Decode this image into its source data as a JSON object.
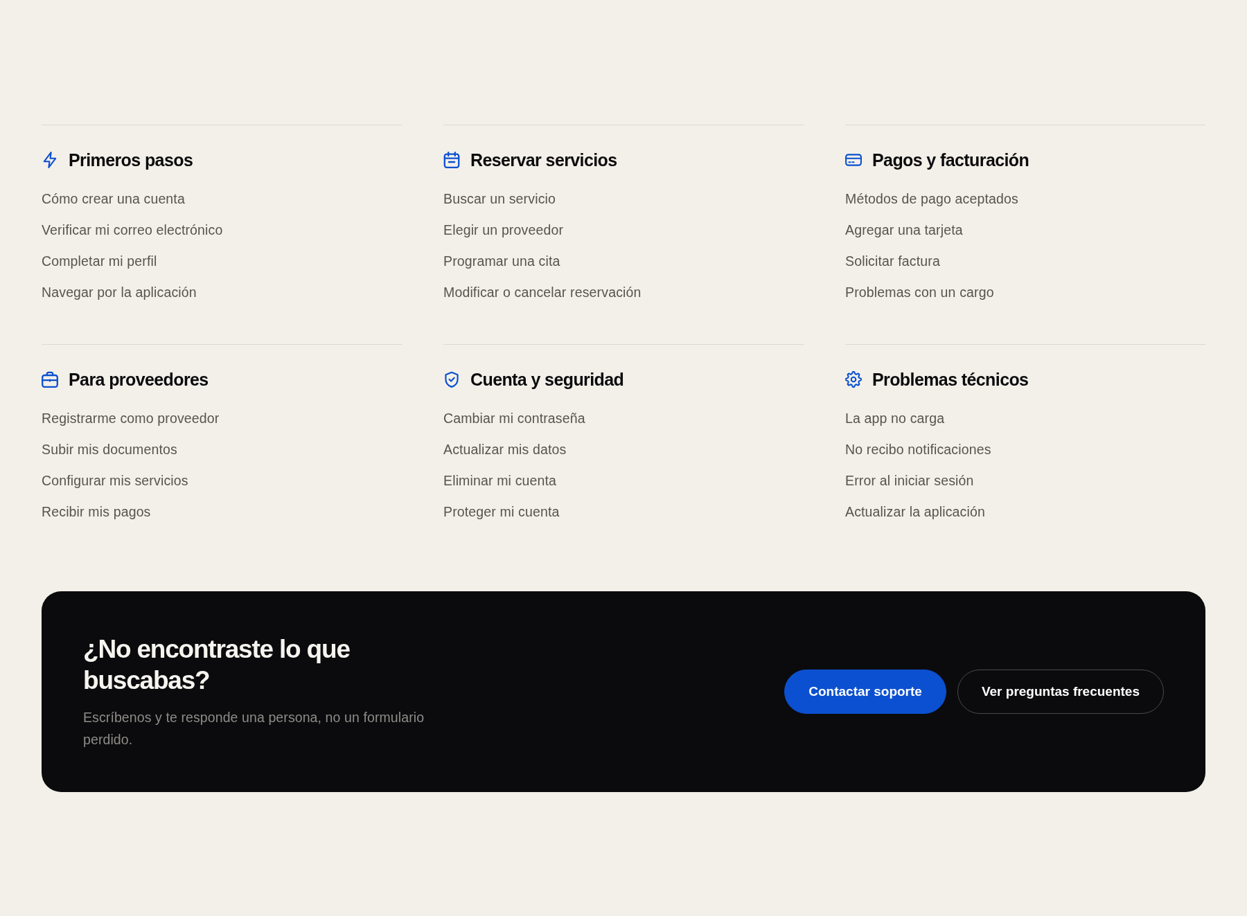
{
  "categories": [
    {
      "title": "Primeros pasos",
      "links": [
        "Cómo crear una cuenta",
        "Verificar mi correo electrónico",
        "Completar mi perfil",
        "Navegar por la aplicación"
      ]
    },
    {
      "title": "Reservar servicios",
      "links": [
        "Buscar un servicio",
        "Elegir un proveedor",
        "Programar una cita",
        "Modificar o cancelar reservación"
      ]
    },
    {
      "title": "Pagos y facturación",
      "links": [
        "Métodos de pago aceptados",
        "Agregar una tarjeta",
        "Solicitar factura",
        "Problemas con un cargo"
      ]
    },
    {
      "title": "Para proveedores",
      "links": [
        "Registrarme como proveedor",
        "Subir mis documentos",
        "Configurar mis servicios",
        "Recibir mis pagos"
      ]
    },
    {
      "title": "Cuenta y seguridad",
      "links": [
        "Cambiar mi contraseña",
        "Actualizar mis datos",
        "Eliminar mi cuenta",
        "Proteger mi cuenta"
      ]
    },
    {
      "title": "Problemas técnicos",
      "links": [
        "La app no carga",
        "No recibo notificaciones",
        "Error al iniciar sesión",
        "Actualizar la aplicación"
      ]
    }
  ],
  "cta": {
    "title": "¿No encontraste lo que buscabas?",
    "text": "Escríbenos y te responde una persona, no un formulario perdido.",
    "buttons": [
      {
        "label": "Contactar soporte",
        "kind": "primary"
      },
      {
        "label": "Ver preguntas frecuentes",
        "kind": "outline"
      }
    ]
  }
}
